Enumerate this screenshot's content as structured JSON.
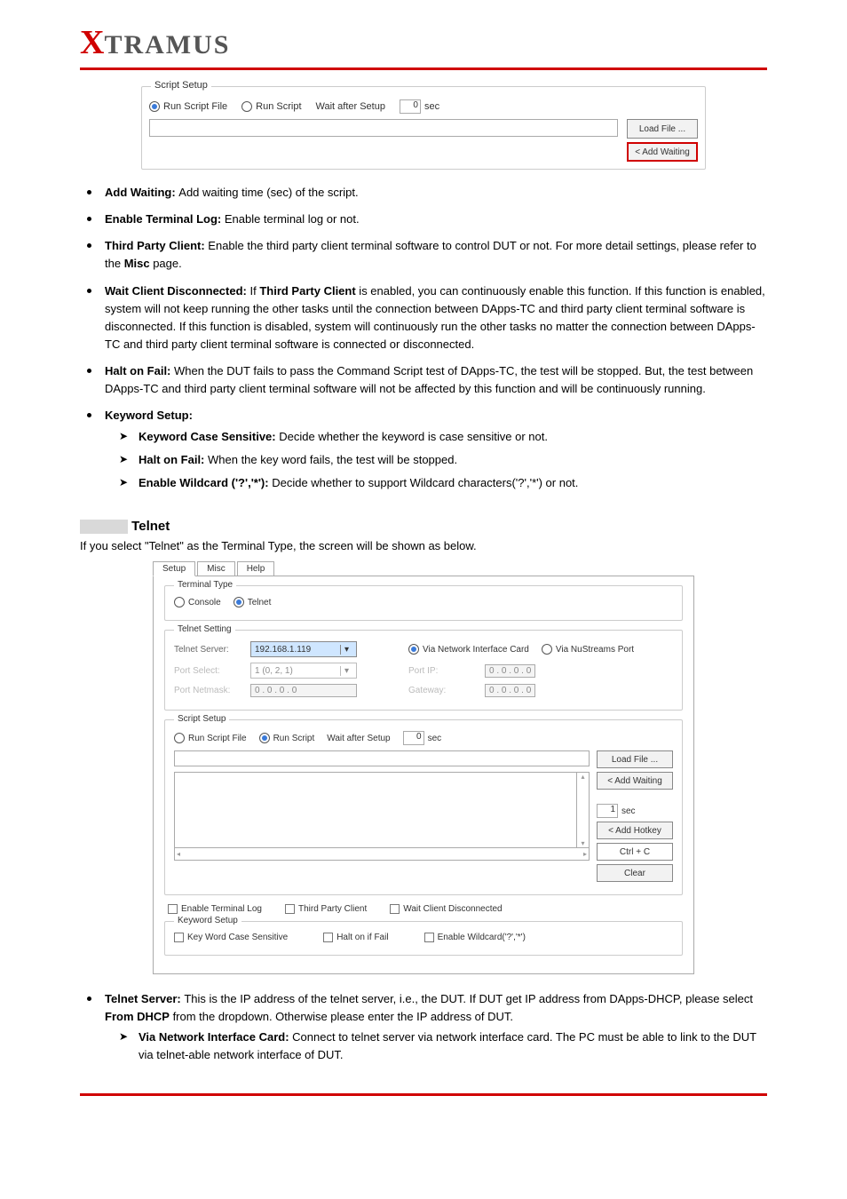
{
  "brand": {
    "x": "X",
    "rest": "TRAMUS"
  },
  "fig1": {
    "legend": "Script Setup",
    "opt1": "Run Script File",
    "opt2": "Run Script",
    "waitLabel": "Wait after Setup",
    "waitVal": "0",
    "waitUnit": "sec",
    "btnLoad": "Load File ...",
    "btnAdd": "< Add Waiting"
  },
  "bullets": {
    "b1a": "Add Waiting: ",
    "b1b": "Add waiting time (sec) of the script.",
    "b2a": "Enable Terminal Log: ",
    "b2b": "Enable terminal log or not.",
    "b3a": "Third Party Client: ",
    "b3b": "Enable the third party client terminal software to control DUT or not. For more detail settings, please refer to the ",
    "b3c": "Misc",
    "b3d": " page.",
    "b4a": "Wait Client Disconnected: ",
    "b4b": "If ",
    "b4c": "Third Party Client",
    "b4d": " is enabled, you can continuously enable this function. If this function is enabled, system will not keep running the other tasks until the connection between DApps-TC and third party client terminal software is disconnected. If this function is disabled, system will continuously run the other tasks no matter the connection between DApps-TC and third party client terminal software is connected or disconnected.",
    "b5a": "Halt on Fail: ",
    "b5b": "When the DUT fails to pass the Command Script test of DApps-TC, the test will be stopped. But, the test between DApps-TC and third party client terminal software will not be affected by this function and will be continuously running.",
    "b6a": "Keyword Setup:",
    "b6c": "Keyword Case Sensitive: ",
    "b6d": "Decide whether the keyword is case sensitive or not.",
    "b6e": "Halt on Fail: ",
    "b6f": "When the key word fails, the test will be stopped.",
    "b6g": "Enable Wildcard ('?','*'): ",
    "b6h": "Decide whether to support Wildcard characters('?','*') or not."
  },
  "section": {
    "title": "Telnet",
    "intro": "If you select \"Telnet\" as the Terminal Type, the screen will be shown as below."
  },
  "fig2": {
    "tab1": "Setup",
    "tab2": "Misc",
    "tab3": "Help",
    "tt_legend": "Terminal Type",
    "tt_console": "Console",
    "tt_telnet": "Telnet",
    "ts_legend": "Telnet Setting",
    "ts_server": "Telnet Server:",
    "ts_server_v": "192.168.1.119",
    "ts_viaNic": "Via Network Interface Card",
    "ts_viaNu": "Via NuStreams Port",
    "ts_portSel": "Port Select:",
    "ts_portSel_v": "1 (0, 2, 1)",
    "ts_portIp": "Port IP:",
    "ip_zero": "0 . 0 . 0 . 0",
    "ts_portNm": "Port Netmask:",
    "ts_gw": "Gateway:",
    "ss_legend": "Script Setup",
    "ss_rfile": "Run Script File",
    "ss_rscript": "Run Script",
    "ss_wait": "Wait after Setup",
    "ss_wait_v": "0",
    "ss_wait_u": "sec",
    "ss_load": "Load File ...",
    "ss_addw": "< Add Waiting",
    "ss_secv": "1",
    "ss_secu": "sec",
    "ss_addh": "< Add Hotkey",
    "ss_ctrl": "Ctrl + C",
    "ss_clear": "Clear",
    "ck_etl": "Enable Terminal Log",
    "ck_tpc": "Third Party Client",
    "ck_wcd": "Wait Client Disconnected",
    "kw_legend": "Keyword Setup",
    "kw_cs": "Key Word Case Sensitive",
    "kw_hof": "Halt on if Fail",
    "kw_wc": "Enable Wildcard('?','*')"
  },
  "after": {
    "b1a": "Telnet Server: ",
    "b1b": "This is the IP address of the telnet server, i.e., the DUT. If DUT get IP address from DApps-DHCP, please select ",
    "b1c": "From DHCP",
    "b1d": " from the dropdown. Otherwise please enter the IP address of DUT.",
    "b2a": "Via Network Interface Card: ",
    "b2b": "Connect to telnet server via network interface card. The PC must be able to link to the DUT via telnet-able network interface of DUT."
  }
}
